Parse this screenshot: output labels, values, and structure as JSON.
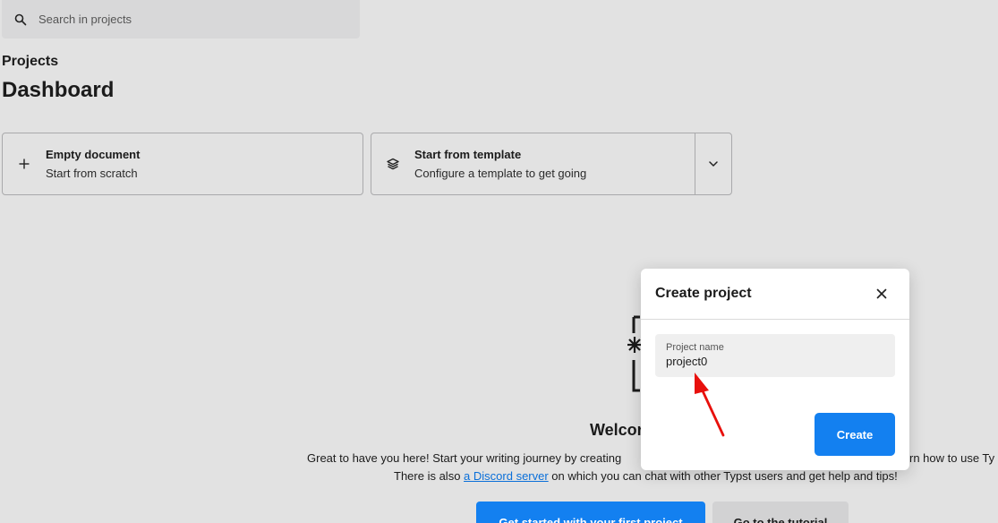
{
  "search": {
    "placeholder": "Search in projects"
  },
  "breadcrumb": "Projects",
  "page_title": "Dashboard",
  "cards": {
    "empty": {
      "title": "Empty document",
      "subtitle": "Start from scratch"
    },
    "template": {
      "title": "Start from template",
      "subtitle": "Configure a template to get going"
    }
  },
  "welcome": {
    "title": "Welcor",
    "line1_start": "Great to have you here! Start your writing journey by creating",
    "line1_end": "rn how to use Ty",
    "line2_before": "There is also ",
    "line2_link": "a Discord server",
    "line2_after": " on which you can chat with other Typst users and get help and tips!"
  },
  "buttons": {
    "primary": "Get started with your first project",
    "secondary": "Go to the tutorial"
  },
  "modal": {
    "title": "Create project",
    "field_label": "Project name",
    "field_value": "project0",
    "create_label": "Create"
  },
  "colors": {
    "accent": "#1380f0",
    "background": "#e2e2e2",
    "annotation": "#e8100c"
  }
}
